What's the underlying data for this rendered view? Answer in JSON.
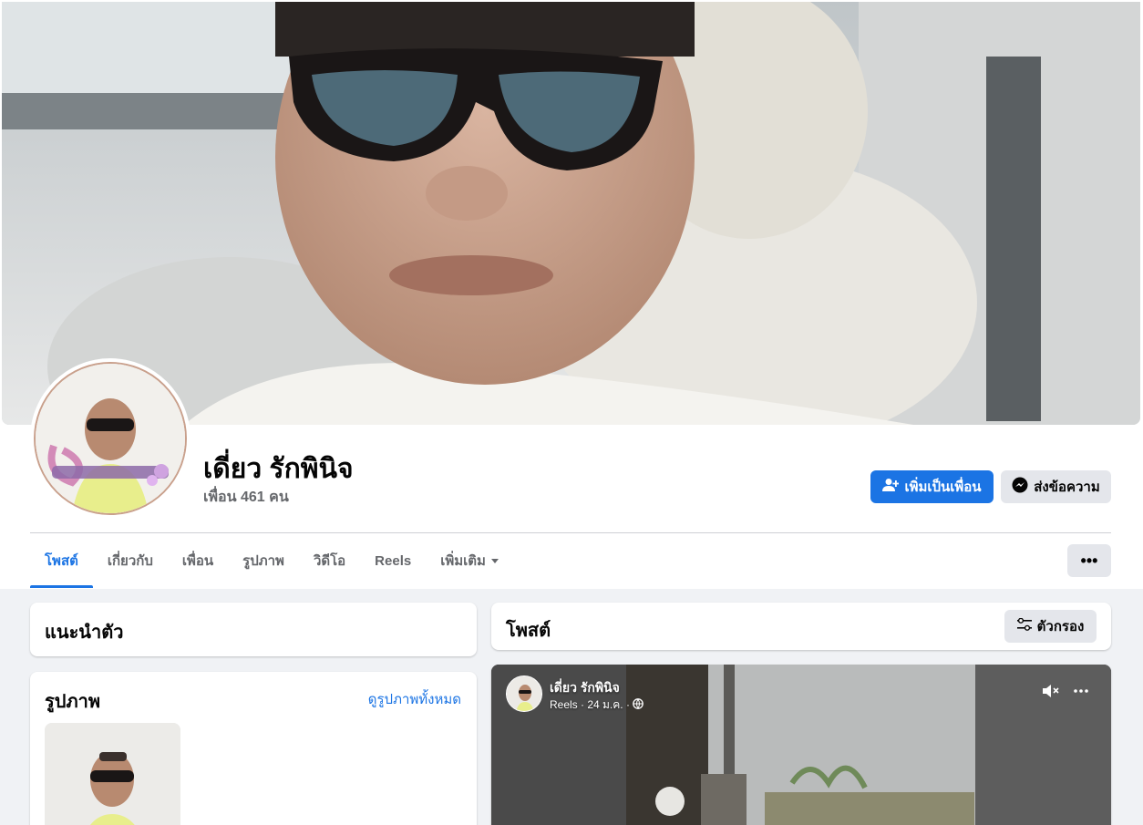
{
  "profile": {
    "name": "เดี่ยว รักพินิจ",
    "friends": "เพื่อน 461 คน"
  },
  "actions": {
    "add_friend": "เพิ่มเป็นเพื่อน",
    "message": "ส่งข้อความ"
  },
  "tabs": [
    {
      "label": "โพสต์",
      "active": true
    },
    {
      "label": "เกี่ยวกับ"
    },
    {
      "label": "เพื่อน"
    },
    {
      "label": "รูปภาพ"
    },
    {
      "label": "วิดีโอ"
    },
    {
      "label": "Reels"
    },
    {
      "label": "เพิ่มเติม"
    }
  ],
  "more_button": "•••",
  "intro": {
    "title": "แนะนำตัว"
  },
  "photos": {
    "title": "รูปภาพ",
    "see_all": "ดูรูปภาพทั้งหมด"
  },
  "posts": {
    "title": "โพสต์",
    "filter": "ตัวกรอง"
  },
  "post": {
    "author": "เดี่ยว รักพินิจ",
    "meta": "Reels · 24 ม.ค. ·"
  },
  "colors": {
    "primary": "#1b74e4",
    "page_bg": "#f0f2f5",
    "secondary_btn": "#e4e6eb"
  },
  "icons": [
    "add-friend-icon",
    "messenger-icon",
    "chevron-down-icon",
    "more-icon",
    "filter-icon",
    "globe-icon",
    "mute-icon"
  ]
}
